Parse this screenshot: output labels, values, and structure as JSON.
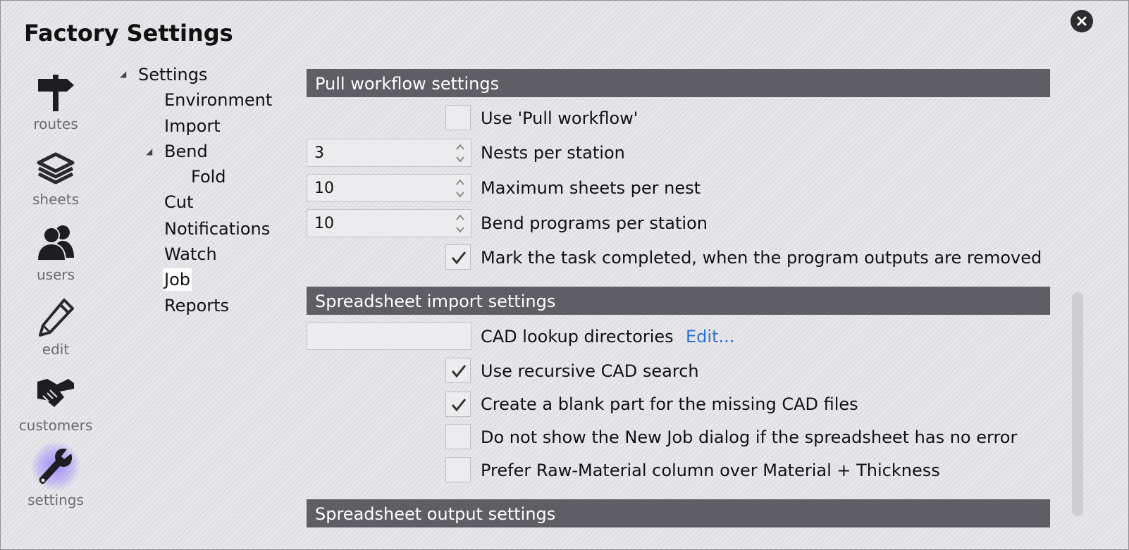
{
  "window": {
    "title": "Factory Settings"
  },
  "rail": [
    {
      "label": "routes",
      "icon": "signpost-icon"
    },
    {
      "label": "sheets",
      "icon": "sheets-stack-icon"
    },
    {
      "label": "users",
      "icon": "users-icon"
    },
    {
      "label": "edit",
      "icon": "pencil-icon"
    },
    {
      "label": "customers",
      "icon": "handshake-icon"
    },
    {
      "label": "settings",
      "icon": "wrench-icon",
      "active": true
    }
  ],
  "tree": {
    "root": "Settings",
    "items": [
      "Environment",
      "Import",
      "Bend",
      "Fold",
      "Cut",
      "Notifications",
      "Watch",
      "Job",
      "Reports"
    ],
    "selected": "Job"
  },
  "sections": {
    "pull": {
      "title": "Pull workflow settings",
      "use_pull_label": "Use 'Pull workflow'",
      "use_pull_checked": false,
      "nests_value": "3",
      "nests_label": "Nests per station",
      "max_sheets_value": "10",
      "max_sheets_label": "Maximum sheets per nest",
      "bend_programs_value": "10",
      "bend_programs_label": "Bend programs per station",
      "mark_completed_label": "Mark the task completed, when the program outputs are removed",
      "mark_completed_checked": true
    },
    "import": {
      "title": "Spreadsheet import settings",
      "cad_dirs_value": "",
      "cad_dirs_label": "CAD lookup directories",
      "edit_link": "Edit...",
      "recursive_label": "Use recursive CAD search",
      "recursive_checked": true,
      "blank_part_label": "Create a blank part for the missing CAD files",
      "blank_part_checked": true,
      "no_dialog_label": "Do not show the New Job dialog if the spreadsheet has no error",
      "no_dialog_checked": false,
      "prefer_raw_label": "Prefer Raw-Material column over Material + Thickness",
      "prefer_raw_checked": false
    },
    "output": {
      "title": "Spreadsheet output settings"
    }
  },
  "colors": {
    "accent": "#7a5cff",
    "header": "#5e5e64",
    "link": "#2f6fd0"
  }
}
